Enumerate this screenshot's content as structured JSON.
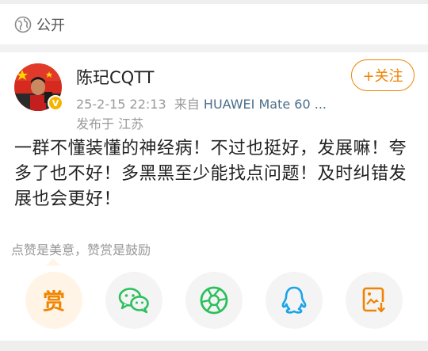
{
  "visibility": {
    "icon": "globe-icon",
    "label": "公开"
  },
  "author": {
    "name": "陈玘CQTT",
    "verified_badge": "V",
    "avatar_icon": "avatar-photo",
    "post_time": "25-2-15 22:13",
    "source_prefix": "来自",
    "source_device": "HUAWEI Mate 60 ...",
    "location": "发布于 江苏"
  },
  "follow_button": {
    "label": "+关注"
  },
  "post": {
    "text": "一群不懂装懂的神经病！不过也挺好，发展嘛！夸多了也不好！多黑黑至少能找点问题！及时纠错发展也会更好！"
  },
  "reward": {
    "caption": "点赞是美意，赞赏是鼓励",
    "button_char": "赏"
  },
  "share_icons": [
    "reward-icon",
    "wechat-icon",
    "moments-icon",
    "qq-icon",
    "save-image-icon"
  ],
  "colors": {
    "accent": "#f08300",
    "wechat": "#2bc05c",
    "qq": "#1aa3e8",
    "link": "#4a6e8a"
  }
}
